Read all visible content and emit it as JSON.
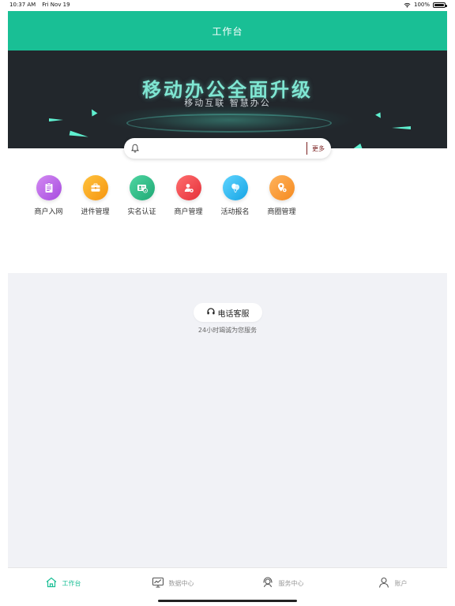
{
  "status_bar": {
    "time": "10:37 AM",
    "date": "Fri Nov 19",
    "battery": "100%"
  },
  "header": {
    "title": "工作台"
  },
  "banner": {
    "title": "移动办公全面升级",
    "subtitle": "移动互联  智慧办公"
  },
  "search": {
    "placeholder": "",
    "more_label": "更多"
  },
  "grid": {
    "items": [
      {
        "label": "商户入网",
        "icon": "clipboard-icon",
        "color": "#b25be6"
      },
      {
        "label": "进件管理",
        "icon": "briefcase-icon",
        "color": "#f7a21b"
      },
      {
        "label": "实名认证",
        "icon": "id-card-icon",
        "color": "#2dbb88"
      },
      {
        "label": "商户管理",
        "icon": "user-settings-icon",
        "color": "#f0484a"
      },
      {
        "label": "活动报名",
        "icon": "balloon-icon",
        "color": "#27b6ef"
      },
      {
        "label": "商圈管理",
        "icon": "location-icon",
        "color": "#f7972e"
      }
    ]
  },
  "service": {
    "button_label": "电话客服",
    "subtitle": "24小时竭诚为您服务"
  },
  "tabbar": {
    "items": [
      {
        "label": "工作台",
        "icon": "home-icon",
        "active": true
      },
      {
        "label": "数据中心",
        "icon": "monitor-chart-icon",
        "active": false
      },
      {
        "label": "服务中心",
        "icon": "headset-icon",
        "active": false
      },
      {
        "label": "账户",
        "icon": "person-icon",
        "active": false
      }
    ]
  },
  "colors": {
    "accent": "#19bf95",
    "banner_bg": "#22272c",
    "page_bg": "#f1f2f6"
  }
}
